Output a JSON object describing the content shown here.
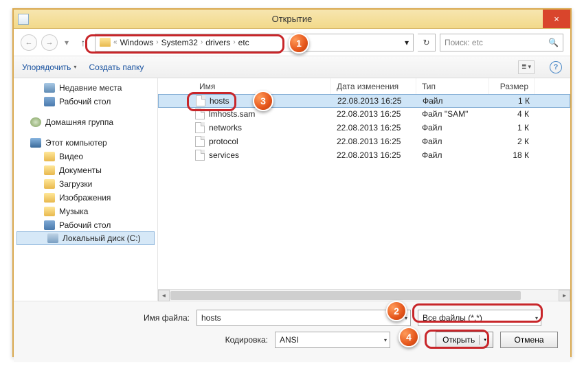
{
  "window": {
    "title": "Открытие",
    "close_icon": "×"
  },
  "nav": {
    "back": "←",
    "forward": "→",
    "recent_drop": "▾",
    "up": "↑",
    "breadcrumb_drop": "▾",
    "breadcrumb": {
      "ellipsis": "«",
      "p1": "Windows",
      "p2": "System32",
      "p3": "drivers",
      "p4": "etc",
      "sep": "›"
    },
    "refresh": "↻",
    "search_placeholder": "Поиск: etc",
    "search_glyph": "🔍"
  },
  "toolbar": {
    "organize": "Упорядочить",
    "new_folder": "Создать папку",
    "view_drop": "▾",
    "help": "?"
  },
  "sidebar": {
    "recent": "Недавние места",
    "desktop1": "Рабочий стол",
    "homegroup": "Домашняя группа",
    "computer": "Этот компьютер",
    "video": "Видео",
    "documents": "Документы",
    "downloads": "Загрузки",
    "pictures": "Изображения",
    "music": "Музыка",
    "desktop2": "Рабочий стол",
    "localdisk": "Локальный диск (C:)"
  },
  "columns": {
    "name": "Имя",
    "date": "Дата изменения",
    "type": "Тип",
    "size": "Размер"
  },
  "files": [
    {
      "name": "hosts",
      "date": "22.08.2013 16:25",
      "type": "Файл",
      "size": "1 К",
      "selected": true
    },
    {
      "name": "lmhosts.sam",
      "date": "22.08.2013 16:25",
      "type": "Файл \"SAM\"",
      "size": "4 К",
      "selected": false
    },
    {
      "name": "networks",
      "date": "22.08.2013 16:25",
      "type": "Файл",
      "size": "1 К",
      "selected": false
    },
    {
      "name": "protocol",
      "date": "22.08.2013 16:25",
      "type": "Файл",
      "size": "2 К",
      "selected": false
    },
    {
      "name": "services",
      "date": "22.08.2013 16:25",
      "type": "Файл",
      "size": "18 К",
      "selected": false
    }
  ],
  "form": {
    "filename_label": "Имя файла:",
    "filename_value": "hosts",
    "filter_value": "Все файлы  (*.*)",
    "encoding_label": "Кодировка:",
    "encoding_value": "ANSI",
    "open_label": "Открыть",
    "cancel_label": "Отмена",
    "drop": "▾"
  },
  "markers": {
    "m1": "1",
    "m2": "2",
    "m3": "3",
    "m4": "4"
  }
}
